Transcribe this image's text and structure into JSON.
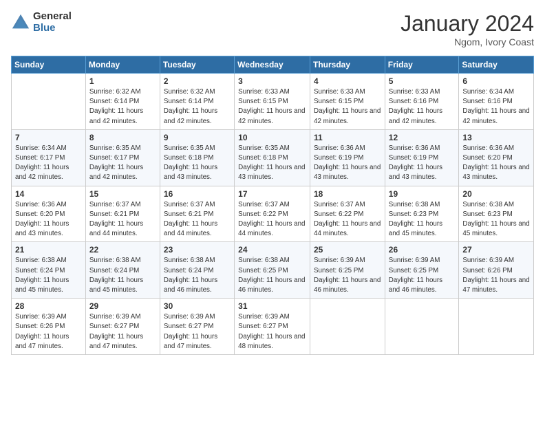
{
  "header": {
    "logo_general": "General",
    "logo_blue": "Blue",
    "title": "January 2024",
    "location": "Ngom, Ivory Coast"
  },
  "weekdays": [
    "Sunday",
    "Monday",
    "Tuesday",
    "Wednesday",
    "Thursday",
    "Friday",
    "Saturday"
  ],
  "weeks": [
    [
      {
        "day": "",
        "sunrise": "",
        "sunset": "",
        "daylight": ""
      },
      {
        "day": "1",
        "sunrise": "Sunrise: 6:32 AM",
        "sunset": "Sunset: 6:14 PM",
        "daylight": "Daylight: 11 hours and 42 minutes."
      },
      {
        "day": "2",
        "sunrise": "Sunrise: 6:32 AM",
        "sunset": "Sunset: 6:14 PM",
        "daylight": "Daylight: 11 hours and 42 minutes."
      },
      {
        "day": "3",
        "sunrise": "Sunrise: 6:33 AM",
        "sunset": "Sunset: 6:15 PM",
        "daylight": "Daylight: 11 hours and 42 minutes."
      },
      {
        "day": "4",
        "sunrise": "Sunrise: 6:33 AM",
        "sunset": "Sunset: 6:15 PM",
        "daylight": "Daylight: 11 hours and 42 minutes."
      },
      {
        "day": "5",
        "sunrise": "Sunrise: 6:33 AM",
        "sunset": "Sunset: 6:16 PM",
        "daylight": "Daylight: 11 hours and 42 minutes."
      },
      {
        "day": "6",
        "sunrise": "Sunrise: 6:34 AM",
        "sunset": "Sunset: 6:16 PM",
        "daylight": "Daylight: 11 hours and 42 minutes."
      }
    ],
    [
      {
        "day": "7",
        "sunrise": "Sunrise: 6:34 AM",
        "sunset": "Sunset: 6:17 PM",
        "daylight": "Daylight: 11 hours and 42 minutes."
      },
      {
        "day": "8",
        "sunrise": "Sunrise: 6:35 AM",
        "sunset": "Sunset: 6:17 PM",
        "daylight": "Daylight: 11 hours and 42 minutes."
      },
      {
        "day": "9",
        "sunrise": "Sunrise: 6:35 AM",
        "sunset": "Sunset: 6:18 PM",
        "daylight": "Daylight: 11 hours and 43 minutes."
      },
      {
        "day": "10",
        "sunrise": "Sunrise: 6:35 AM",
        "sunset": "Sunset: 6:18 PM",
        "daylight": "Daylight: 11 hours and 43 minutes."
      },
      {
        "day": "11",
        "sunrise": "Sunrise: 6:36 AM",
        "sunset": "Sunset: 6:19 PM",
        "daylight": "Daylight: 11 hours and 43 minutes."
      },
      {
        "day": "12",
        "sunrise": "Sunrise: 6:36 AM",
        "sunset": "Sunset: 6:19 PM",
        "daylight": "Daylight: 11 hours and 43 minutes."
      },
      {
        "day": "13",
        "sunrise": "Sunrise: 6:36 AM",
        "sunset": "Sunset: 6:20 PM",
        "daylight": "Daylight: 11 hours and 43 minutes."
      }
    ],
    [
      {
        "day": "14",
        "sunrise": "Sunrise: 6:36 AM",
        "sunset": "Sunset: 6:20 PM",
        "daylight": "Daylight: 11 hours and 43 minutes."
      },
      {
        "day": "15",
        "sunrise": "Sunrise: 6:37 AM",
        "sunset": "Sunset: 6:21 PM",
        "daylight": "Daylight: 11 hours and 44 minutes."
      },
      {
        "day": "16",
        "sunrise": "Sunrise: 6:37 AM",
        "sunset": "Sunset: 6:21 PM",
        "daylight": "Daylight: 11 hours and 44 minutes."
      },
      {
        "day": "17",
        "sunrise": "Sunrise: 6:37 AM",
        "sunset": "Sunset: 6:22 PM",
        "daylight": "Daylight: 11 hours and 44 minutes."
      },
      {
        "day": "18",
        "sunrise": "Sunrise: 6:37 AM",
        "sunset": "Sunset: 6:22 PM",
        "daylight": "Daylight: 11 hours and 44 minutes."
      },
      {
        "day": "19",
        "sunrise": "Sunrise: 6:38 AM",
        "sunset": "Sunset: 6:23 PM",
        "daylight": "Daylight: 11 hours and 45 minutes."
      },
      {
        "day": "20",
        "sunrise": "Sunrise: 6:38 AM",
        "sunset": "Sunset: 6:23 PM",
        "daylight": "Daylight: 11 hours and 45 minutes."
      }
    ],
    [
      {
        "day": "21",
        "sunrise": "Sunrise: 6:38 AM",
        "sunset": "Sunset: 6:24 PM",
        "daylight": "Daylight: 11 hours and 45 minutes."
      },
      {
        "day": "22",
        "sunrise": "Sunrise: 6:38 AM",
        "sunset": "Sunset: 6:24 PM",
        "daylight": "Daylight: 11 hours and 45 minutes."
      },
      {
        "day": "23",
        "sunrise": "Sunrise: 6:38 AM",
        "sunset": "Sunset: 6:24 PM",
        "daylight": "Daylight: 11 hours and 46 minutes."
      },
      {
        "day": "24",
        "sunrise": "Sunrise: 6:38 AM",
        "sunset": "Sunset: 6:25 PM",
        "daylight": "Daylight: 11 hours and 46 minutes."
      },
      {
        "day": "25",
        "sunrise": "Sunrise: 6:39 AM",
        "sunset": "Sunset: 6:25 PM",
        "daylight": "Daylight: 11 hours and 46 minutes."
      },
      {
        "day": "26",
        "sunrise": "Sunrise: 6:39 AM",
        "sunset": "Sunset: 6:25 PM",
        "daylight": "Daylight: 11 hours and 46 minutes."
      },
      {
        "day": "27",
        "sunrise": "Sunrise: 6:39 AM",
        "sunset": "Sunset: 6:26 PM",
        "daylight": "Daylight: 11 hours and 47 minutes."
      }
    ],
    [
      {
        "day": "28",
        "sunrise": "Sunrise: 6:39 AM",
        "sunset": "Sunset: 6:26 PM",
        "daylight": "Daylight: 11 hours and 47 minutes."
      },
      {
        "day": "29",
        "sunrise": "Sunrise: 6:39 AM",
        "sunset": "Sunset: 6:27 PM",
        "daylight": "Daylight: 11 hours and 47 minutes."
      },
      {
        "day": "30",
        "sunrise": "Sunrise: 6:39 AM",
        "sunset": "Sunset: 6:27 PM",
        "daylight": "Daylight: 11 hours and 47 minutes."
      },
      {
        "day": "31",
        "sunrise": "Sunrise: 6:39 AM",
        "sunset": "Sunset: 6:27 PM",
        "daylight": "Daylight: 11 hours and 48 minutes."
      },
      {
        "day": "",
        "sunrise": "",
        "sunset": "",
        "daylight": ""
      },
      {
        "day": "",
        "sunrise": "",
        "sunset": "",
        "daylight": ""
      },
      {
        "day": "",
        "sunrise": "",
        "sunset": "",
        "daylight": ""
      }
    ]
  ]
}
